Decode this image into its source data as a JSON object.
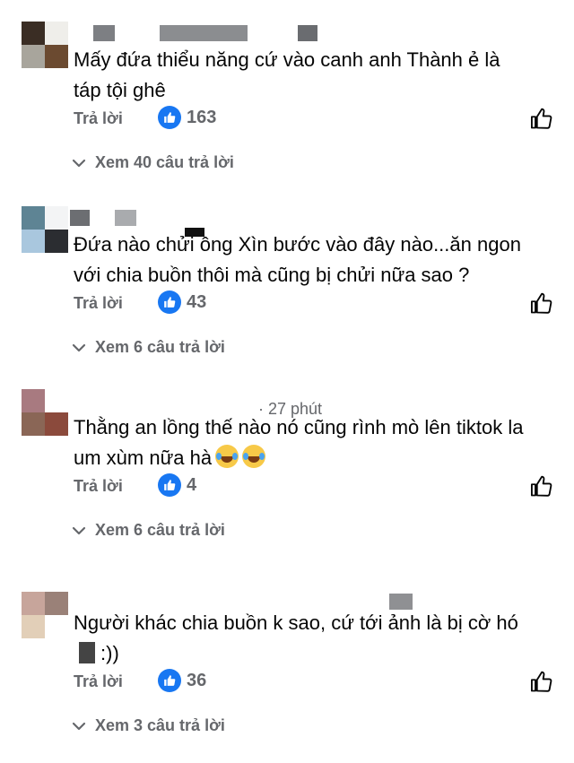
{
  "comments": [
    {
      "text": "Mấy đứa thiểu năng cứ vào canh anh Thành ẻ là\ntáp tội ghê",
      "meta": "",
      "reply_label": "Trả lời",
      "like_count": "163",
      "view_replies": "Xem 40 câu trả lời"
    },
    {
      "text": "Đứa nào chửi ông Xìn bước vào đây nào...ăn ngon\nvới chia buồn thôi mà cũng bị chửi nữa sao ?",
      "meta": "",
      "reply_label": "Trả lời",
      "like_count": "43",
      "view_replies": "Xem 6 câu trả lời"
    },
    {
      "text": "Thằng an lồng thế nào nó cũng rình mò lên tiktok la\num xùm nữa hà",
      "meta": "· 27 phút",
      "reply_label": "Trả lời",
      "like_count": "4",
      "view_replies": "Xem 6 câu trả lời"
    },
    {
      "text": "Người khác chia buồn k sao, cứ tới ảnh là bị cờ hó",
      "text_line2": ":))",
      "meta": "",
      "reply_label": "Trả lời",
      "like_count": "36",
      "view_replies": "Xem 3 câu trả lời"
    }
  ],
  "icons": {
    "like_badge": "thumbs-up-icon",
    "like_outline": "thumbs-up-outline-icon",
    "view_chevron": "chevron-down-icon",
    "emoji": "laughing-tears-emoji-icon"
  },
  "colors": {
    "like_blue": "#1877f2",
    "secondary_text": "#65676b",
    "primary_text": "#050505"
  }
}
